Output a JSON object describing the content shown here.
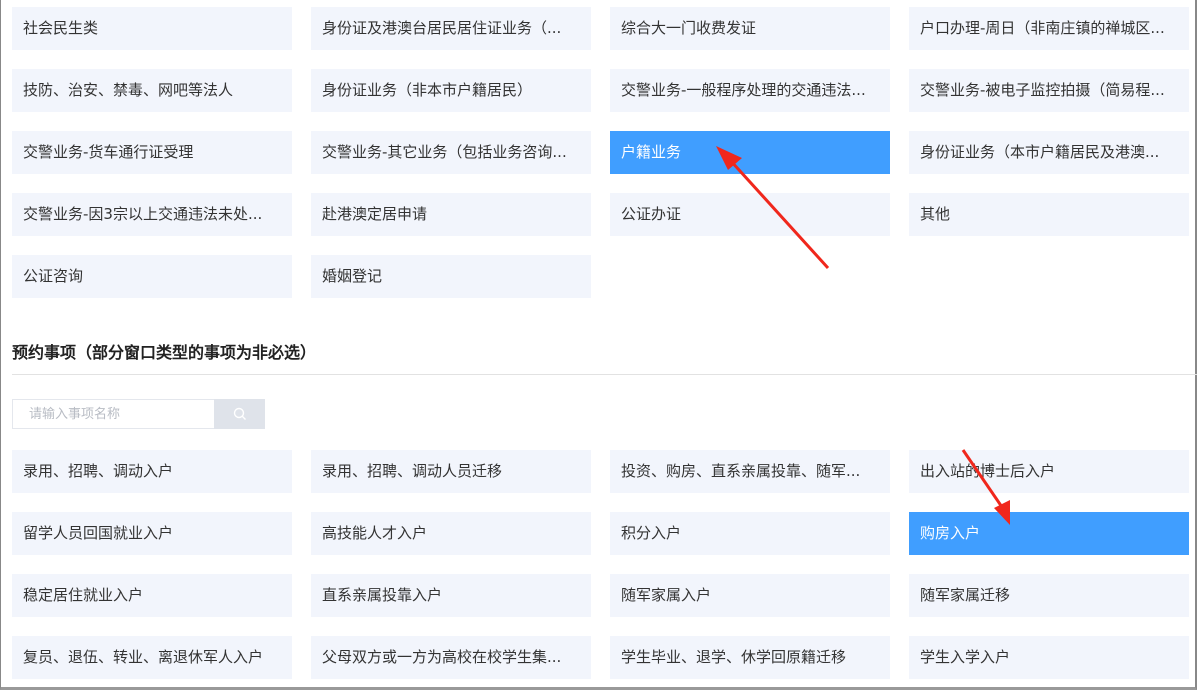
{
  "window_types": [
    {
      "label": "社会民生类",
      "selected": false
    },
    {
      "label": "身份证及港澳台居民居住证业务（...",
      "selected": false
    },
    {
      "label": "综合大一门收费发证",
      "selected": false
    },
    {
      "label": "户口办理-周日（非南庄镇的禅城区...",
      "selected": false
    },
    {
      "label": "技防、治安、禁毒、网吧等法人",
      "selected": false
    },
    {
      "label": "身份证业务（非本市户籍居民）",
      "selected": false
    },
    {
      "label": "交警业务-一般程序处理的交通违法...",
      "selected": false
    },
    {
      "label": "交警业务-被电子监控拍摄（简易程...",
      "selected": false
    },
    {
      "label": "交警业务-货车通行证受理",
      "selected": false
    },
    {
      "label": "交警业务-其它业务（包括业务咨询...",
      "selected": false
    },
    {
      "label": "户籍业务",
      "selected": true
    },
    {
      "label": "身份证业务（本市户籍居民及港澳...",
      "selected": false
    },
    {
      "label": "交警业务-因3宗以上交通违法未处...",
      "selected": false
    },
    {
      "label": "赴港澳定居申请",
      "selected": false
    },
    {
      "label": "公证办证",
      "selected": false
    },
    {
      "label": "其他",
      "selected": false
    },
    {
      "label": "公证咨询",
      "selected": false
    },
    {
      "label": "婚姻登记",
      "selected": false
    }
  ],
  "matters_section": {
    "title": "预约事项（部分窗口类型的事项为非必选）",
    "search_placeholder": "请输入事项名称",
    "search_icon": "search-icon",
    "items": [
      {
        "label": "录用、招聘、调动入户",
        "selected": false
      },
      {
        "label": "录用、招聘、调动人员迁移",
        "selected": false
      },
      {
        "label": "投资、购房、直系亲属投靠、随军...",
        "selected": false
      },
      {
        "label": "出入站的博士后入户",
        "selected": false
      },
      {
        "label": "留学人员回国就业入户",
        "selected": false
      },
      {
        "label": "高技能人才入户",
        "selected": false
      },
      {
        "label": "积分入户",
        "selected": false
      },
      {
        "label": "购房入户",
        "selected": true
      },
      {
        "label": "稳定居住就业入户",
        "selected": false
      },
      {
        "label": "直系亲属投靠入户",
        "selected": false
      },
      {
        "label": "随军家属入户",
        "selected": false
      },
      {
        "label": "随军家属迁移",
        "selected": false
      },
      {
        "label": "复员、退伍、转业、离退休军人入户",
        "selected": false
      },
      {
        "label": "父母双方或一方为高校在校学生集...",
        "selected": false
      },
      {
        "label": "学生毕业、退学、休学回原籍迁移",
        "selected": false
      },
      {
        "label": "学生入学入户",
        "selected": false
      }
    ]
  },
  "colors": {
    "accent": "#409eff",
    "item_bg": "#f2f5fc",
    "arrow": "#f0271c"
  }
}
